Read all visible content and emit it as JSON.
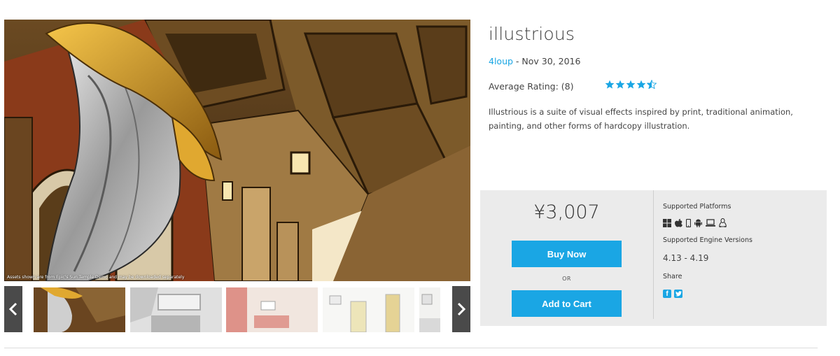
{
  "product": {
    "title": "illustrious",
    "seller": "4loup",
    "date_sep": " - ",
    "date": "Nov 30, 2016",
    "rating_label": "Average Rating: (8)",
    "rating_value": 4.5,
    "rating_max": 5,
    "description": "Illustrious is a suite of visual effects inspired by print, traditional animation, painting, and other forms of hardcopy illustration."
  },
  "gallery": {
    "caption": "Assets shown are from Epic's Sun Temple Demo and may be downloaded separately",
    "thumbnails": [
      "thumbnail-1",
      "thumbnail-2",
      "thumbnail-3",
      "thumbnail-4",
      "thumbnail-5"
    ]
  },
  "purchase": {
    "price": "¥3,007",
    "buy_label": "Buy Now",
    "or_label": "OR",
    "cart_label": "Add to Cart"
  },
  "info": {
    "platforms_label": "Supported Platforms",
    "platforms": [
      "windows-icon",
      "apple-icon",
      "mobile-icon",
      "android-icon",
      "laptop-icon",
      "linux-icon"
    ],
    "engine_label": "Supported Engine Versions",
    "engine_versions": "4.13 - 4.19",
    "share_label": "Share",
    "share": [
      "facebook-icon",
      "twitter-icon"
    ]
  },
  "colors": {
    "accent": "#1aa6e4",
    "panel": "#ebebeb",
    "nav": "#4a4a4a"
  }
}
